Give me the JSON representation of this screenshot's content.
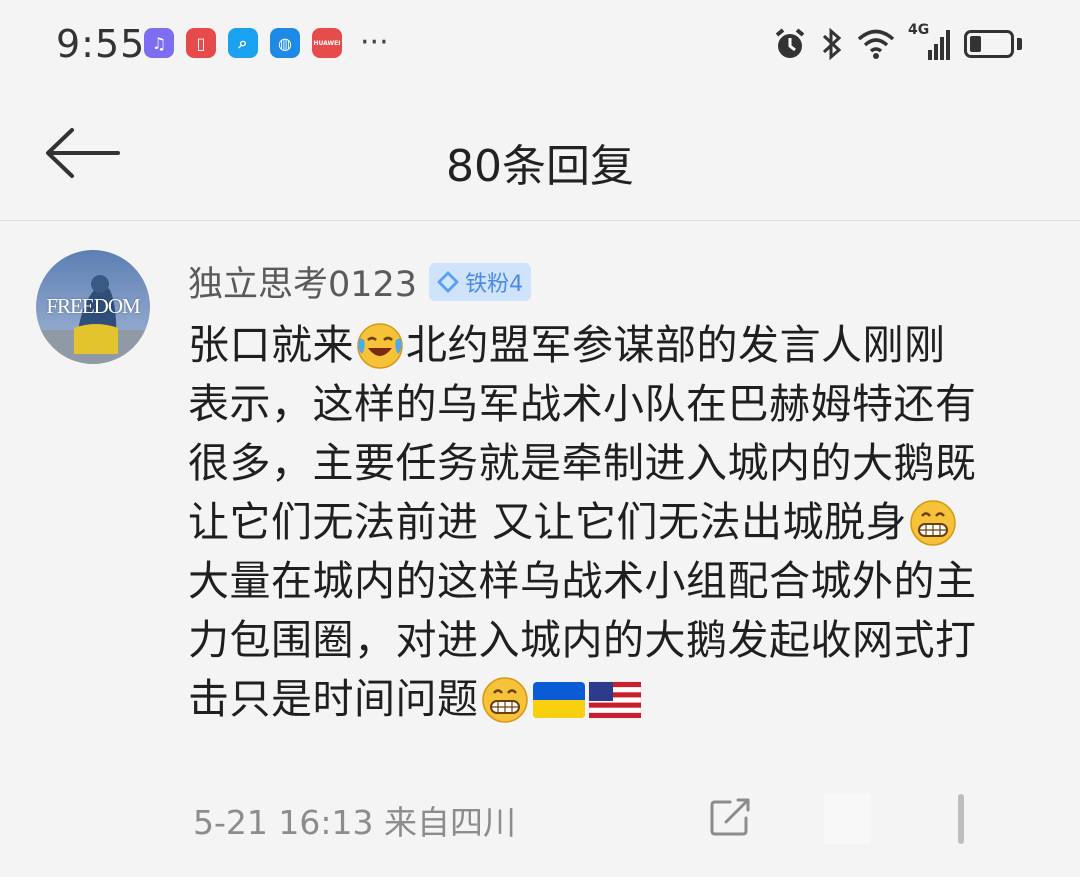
{
  "status_bar": {
    "time": "9:55",
    "app_icons": [
      {
        "name": "music-app-icon",
        "color": "#7d6df0",
        "glyph": "♫"
      },
      {
        "name": "reader-app-icon",
        "color": "#e64a4a",
        "glyph": "▯"
      },
      {
        "name": "search-app-icon",
        "color": "#1aa2f0",
        "glyph": "⌕"
      },
      {
        "name": "browser-app-icon",
        "color": "#1d8ae6",
        "glyph": "◍"
      },
      {
        "name": "huawei-app-icon",
        "color": "#e74c4c",
        "glyph": "HUAWEI"
      }
    ],
    "more": "···",
    "network_label": "4G",
    "battery_level": 0.3
  },
  "header": {
    "title": "80条回复"
  },
  "comment": {
    "username": "独立思考0123",
    "badge_label": "铁粉4",
    "avatar_text": "FREEDOM",
    "lines": [
      {
        "segments": [
          {
            "t": "text",
            "v": "张口就来"
          },
          {
            "t": "emoji",
            "v": "crying-laughing"
          },
          {
            "t": "text",
            "v": "北约盟军参谋部的发言人刚刚"
          }
        ]
      },
      {
        "segments": [
          {
            "t": "text",
            "v": "表示，这样的乌军战术小队在巴赫姆特还有"
          }
        ]
      },
      {
        "segments": [
          {
            "t": "text",
            "v": "很多，主要任务就是牵制进入城内的大鹅既"
          }
        ]
      },
      {
        "segments": [
          {
            "t": "text",
            "v": "让它们无法前进 又让它们无法出城脱身"
          },
          {
            "t": "emoji",
            "v": "grinning"
          }
        ]
      },
      {
        "segments": [
          {
            "t": "text",
            "v": "大量在城内的这样乌战术小组配合城外的主"
          }
        ]
      },
      {
        "segments": [
          {
            "t": "text",
            "v": "力包围圈，对进入城内的大鹅发起收网式打"
          }
        ]
      },
      {
        "segments": [
          {
            "t": "text",
            "v": "击只是时间问题"
          },
          {
            "t": "emoji",
            "v": "grinning"
          },
          {
            "t": "flag",
            "v": "ukraine"
          },
          {
            "t": "flag",
            "v": "usa"
          }
        ]
      }
    ],
    "timestamp": "5-21 16:13",
    "location": "来自四川"
  },
  "colors": {
    "background": "#f4f4f4",
    "badge_bg": "#cfe3fb",
    "badge_text": "#4a8be8",
    "meta_text": "#8c8c8c"
  }
}
